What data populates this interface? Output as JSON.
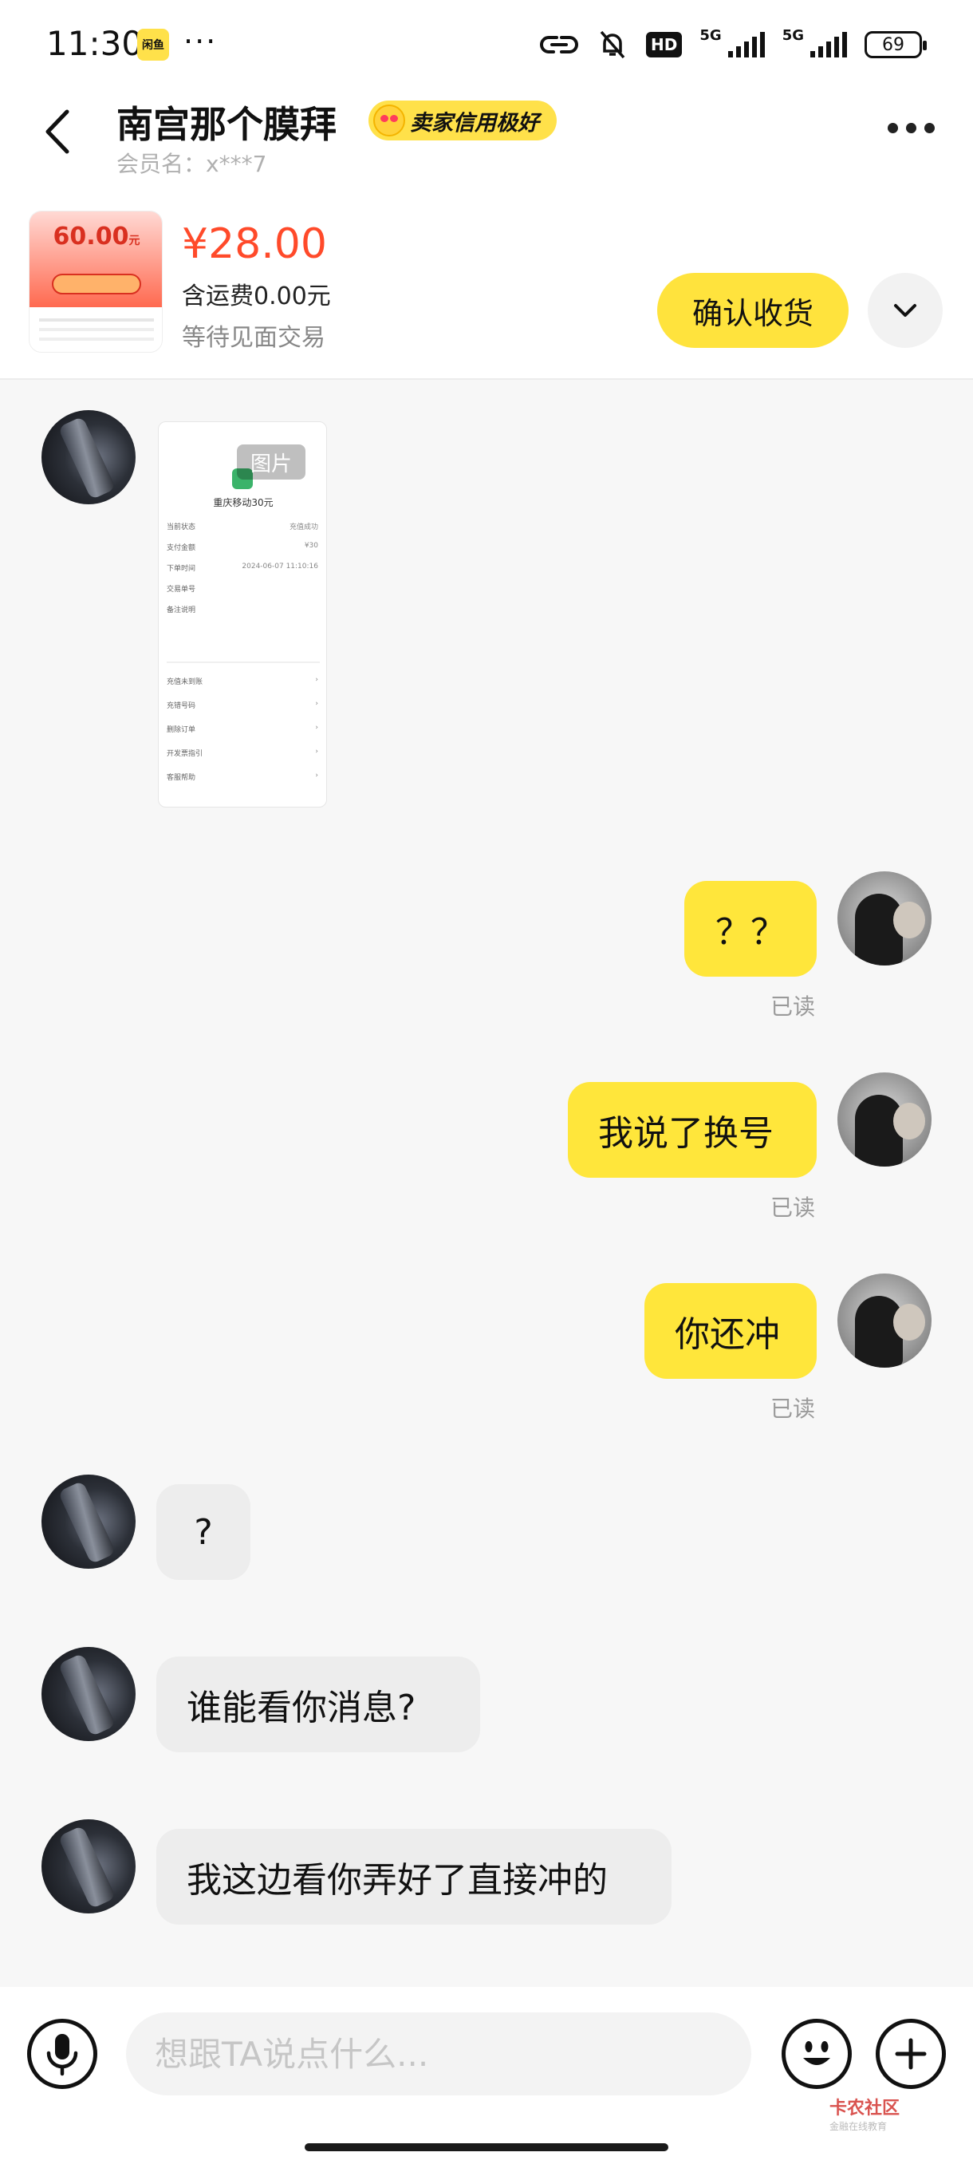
{
  "status_bar": {
    "time": "11:30",
    "app_badge": "闲鱼",
    "more": "···",
    "hd": "HD",
    "network_1": "5G",
    "network_2": "5G",
    "battery": "69"
  },
  "header": {
    "contact_name": "南宫那个膜拜",
    "credit_badge": "卖家信用极好",
    "member_name": "会员名：x***7"
  },
  "product": {
    "thumb_amount": "60.00",
    "thumb_unit": "元",
    "price": "¥28.00",
    "shipping": "含运费0.00元",
    "status": "等待见面交易",
    "confirm_label": "确认收货"
  },
  "image_message": {
    "tag": "图片",
    "title": "重庆移动30元",
    "rows": [
      {
        "label": "当前状态",
        "value": "充值成功"
      },
      {
        "label": "支付金额",
        "value": "¥30"
      },
      {
        "label": "下单时间",
        "value": "2024-06-07 11:10:16"
      },
      {
        "label": "交易单号",
        "value": ""
      },
      {
        "label": "备注说明",
        "value": ""
      },
      {
        "label": "充值未到账",
        "value": "›"
      },
      {
        "label": "充错号码",
        "value": "›"
      },
      {
        "label": "删除订单",
        "value": "›"
      },
      {
        "label": "开发票指引",
        "value": "›"
      },
      {
        "label": "客服帮助",
        "value": "›"
      }
    ]
  },
  "messages": [
    {
      "text": "？？",
      "read": "已读"
    },
    {
      "text": "我说了换号",
      "read": "已读"
    },
    {
      "text": "你还冲",
      "read": "已读"
    },
    {
      "text": "?"
    },
    {
      "text": "谁能看你消息?"
    },
    {
      "text": "我这边看你弄好了直接冲的"
    }
  ],
  "input": {
    "placeholder": "想跟TA说点什么..."
  },
  "watermark": {
    "title": "卡农社区",
    "subtitle": "金融在线教育"
  },
  "colors": {
    "accent": "#ffe33d",
    "price": "#ff4a2a",
    "read": "#9a9a9a"
  }
}
